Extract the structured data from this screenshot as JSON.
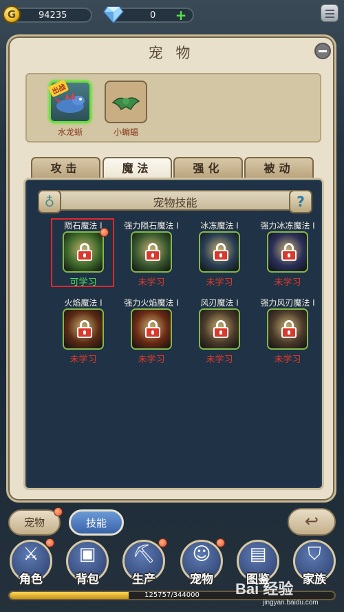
{
  "currency": {
    "gold": "94235",
    "gems": "0",
    "gold_icon": "gold-coin-icon",
    "gem_icon": "diamond-icon"
  },
  "panel": {
    "title": "宠 物"
  },
  "pets": [
    {
      "name": "水龙蜥",
      "active": true,
      "tag": "出战"
    },
    {
      "name": "小蝙蝠",
      "active": false
    }
  ],
  "tabs": [
    {
      "label": "攻击",
      "selected": false
    },
    {
      "label": "魔法",
      "selected": true
    },
    {
      "label": "强化",
      "selected": false
    },
    {
      "label": "被动",
      "selected": false
    }
  ],
  "skill_panel": {
    "title": "宠物技能",
    "help": "?"
  },
  "skills": [
    {
      "name": "陨石魔法 I",
      "status": "可学习",
      "learnable": true,
      "color": "#3e6a2a",
      "badge": true
    },
    {
      "name": "强力陨石魔法 I",
      "status": "未学习",
      "learnable": false,
      "color": "#3a5a30"
    },
    {
      "name": "冰冻魔法 I",
      "status": "未学习",
      "learnable": false,
      "color": "#2a3f55"
    },
    {
      "name": "强力冰冻魔法 I",
      "status": "未学习",
      "learnable": false,
      "color": "#2a2f5a"
    },
    {
      "name": "火焰魔法 I",
      "status": "未学习",
      "learnable": false,
      "color": "#5a2a14"
    },
    {
      "name": "强力火焰魔法 I",
      "status": "未学习",
      "learnable": false,
      "color": "#6a2a14"
    },
    {
      "name": "风刃魔法 I",
      "status": "未学习",
      "learnable": false,
      "color": "#4a3a2a"
    },
    {
      "name": "强力风刃魔法 I",
      "status": "未学习",
      "learnable": false,
      "color": "#4a3a2a"
    }
  ],
  "sub_tabs": {
    "pet": "宠物",
    "skills": "技能"
  },
  "nav": [
    {
      "label": "角色",
      "icon": "warrior-icon",
      "badge": true
    },
    {
      "label": "背包",
      "icon": "backpack-icon",
      "badge": false
    },
    {
      "label": "生产",
      "icon": "pickaxe-icon",
      "badge": true
    },
    {
      "label": "宠物",
      "icon": "pet-icon",
      "badge": true
    },
    {
      "label": "图鉴",
      "icon": "book-icon",
      "badge": false
    },
    {
      "label": "家族",
      "icon": "shield-icon",
      "badge": false
    }
  ],
  "xp": {
    "text": "125757/344000",
    "fraction": 0.3656
  },
  "watermark": {
    "main": "Bai 经验",
    "sub": "jingyan.baidu.com"
  }
}
